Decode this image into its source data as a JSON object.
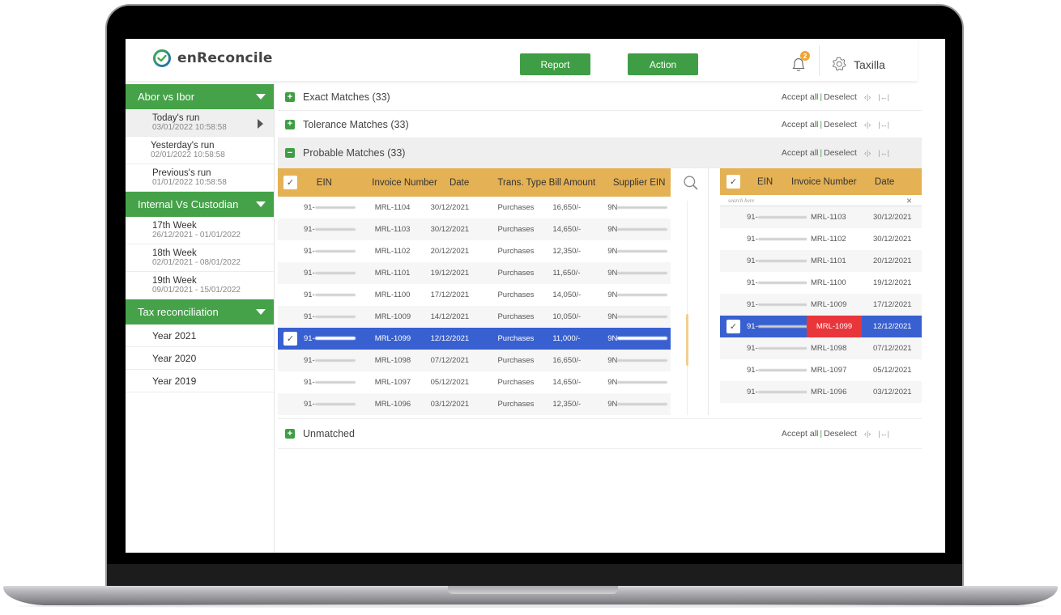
{
  "app": {
    "name": "enReconcile",
    "colors": {
      "brand_green": "#45a249",
      "header_gold": "#e4b154",
      "selected_blue": "#3960d0",
      "mismatch_red": "#e8363b",
      "badge_orange": "#f0a531"
    }
  },
  "header": {
    "report_label": "Report",
    "action_label": "Action",
    "notification_count": "2",
    "user_name": "Taxilla",
    "icons": [
      "logo-check-icon",
      "bell-icon",
      "gear-icon"
    ]
  },
  "sidebar": {
    "groups": [
      {
        "title": "Abor vs Ibor",
        "items": [
          {
            "label": "Today's run",
            "sub": "03/01/2022 10:58:58",
            "active": true
          },
          {
            "label": "Yesterday's run",
            "sub": "02/01/2022 10:58:58"
          },
          {
            "label": "Previous's run",
            "sub": "01/01/2022 10:58:58"
          }
        ]
      },
      {
        "title": "Internal Vs Custodian",
        "items": [
          {
            "label": "17th Week",
            "sub": "26/12/2021 - 01/01/2022"
          },
          {
            "label": "18th Week",
            "sub": "02/01/2021 - 08/01/2022"
          },
          {
            "label": "19th Week",
            "sub": "09/01/2021 - 15/01/2022"
          }
        ]
      },
      {
        "title": "Tax reconciliation",
        "items": [
          {
            "label": "Year 2021"
          },
          {
            "label": "Year 2020"
          },
          {
            "label": "Year 2019"
          }
        ]
      }
    ]
  },
  "sections": {
    "accept_all": "Accept all",
    "separator": "|",
    "deselect": "Deselect",
    "exact": {
      "title": "Exact Matches (33)",
      "expanded": false
    },
    "tolerance": {
      "title": "Tolerance Matches (33)",
      "expanded": false
    },
    "probable": {
      "title": "Probable Matches (33)",
      "expanded": true
    },
    "unmatched": {
      "title": "Unmatched",
      "expanded": false
    }
  },
  "left_table": {
    "columns": [
      "EIN",
      "Invoice Number",
      "Date",
      "Trans. Type",
      "Bill Amount",
      "Supplier EIN"
    ],
    "rows": [
      {
        "ein": "91-",
        "invoice": "MRL-1104",
        "date": "30/12/2021",
        "type": "Purchases",
        "amount": "16,650/-",
        "supplier": "9N"
      },
      {
        "ein": "91-",
        "invoice": "MRL-1103",
        "date": "30/12/2021",
        "type": "Purchases",
        "amount": "14,650/-",
        "supplier": "9N"
      },
      {
        "ein": "91-",
        "invoice": "MRL-1102",
        "date": "20/12/2021",
        "type": "Purchases",
        "amount": "12,350/-",
        "supplier": "9N"
      },
      {
        "ein": "91-",
        "invoice": "MRL-1101",
        "date": "19/12/2021",
        "type": "Purchases",
        "amount": "11,650/-",
        "supplier": "9N"
      },
      {
        "ein": "91-",
        "invoice": "MRL-1100",
        "date": "17/12/2021",
        "type": "Purchases",
        "amount": "14,050/-",
        "supplier": "9N"
      },
      {
        "ein": "91-",
        "invoice": "MRL-1009",
        "date": "14/12/2021",
        "type": "Purchases",
        "amount": "10,050/-",
        "supplier": "9N"
      },
      {
        "ein": "91-",
        "invoice": "MRL-1099",
        "date": "12/12/2021",
        "type": "Purchases",
        "amount": "11,000/-",
        "supplier": "9N",
        "selected": true
      },
      {
        "ein": "91-",
        "invoice": "MRL-1098",
        "date": "07/12/2021",
        "type": "Purchases",
        "amount": "16,650/-",
        "supplier": "9N"
      },
      {
        "ein": "91-",
        "invoice": "MRL-1097",
        "date": "05/12/2021",
        "type": "Purchases",
        "amount": "14,650/-",
        "supplier": "9N"
      },
      {
        "ein": "91-",
        "invoice": "MRL-1096",
        "date": "03/12/2021",
        "type": "Purchases",
        "amount": "12,350/-",
        "supplier": "9N"
      }
    ]
  },
  "right_table": {
    "columns": [
      "EIN",
      "Invoice Number",
      "Date"
    ],
    "search_placeholder": "search here",
    "clear_icon": "×",
    "rows": [
      {
        "ein": "91-",
        "invoice": "MRL-1103",
        "date": "30/12/2021"
      },
      {
        "ein": "91-",
        "invoice": "MRL-1102",
        "date": "30/12/2021"
      },
      {
        "ein": "91-",
        "invoice": "MRL-1101",
        "date": "20/12/2021"
      },
      {
        "ein": "91-",
        "invoice": "MRL-1100",
        "date": "19/12/2021"
      },
      {
        "ein": "91-",
        "invoice": "MRL-1009",
        "date": "17/12/2021"
      },
      {
        "ein": "91-",
        "invoice": "MRL-1099",
        "date": "12/12/2021",
        "selected": true,
        "mismatch": true
      },
      {
        "ein": "91-",
        "invoice": "MRL-1098",
        "date": "07/12/2021"
      },
      {
        "ein": "91-",
        "invoice": "MRL-1097",
        "date": "05/12/2021"
      },
      {
        "ein": "91-",
        "invoice": "MRL-1096",
        "date": "03/12/2021"
      }
    ]
  }
}
